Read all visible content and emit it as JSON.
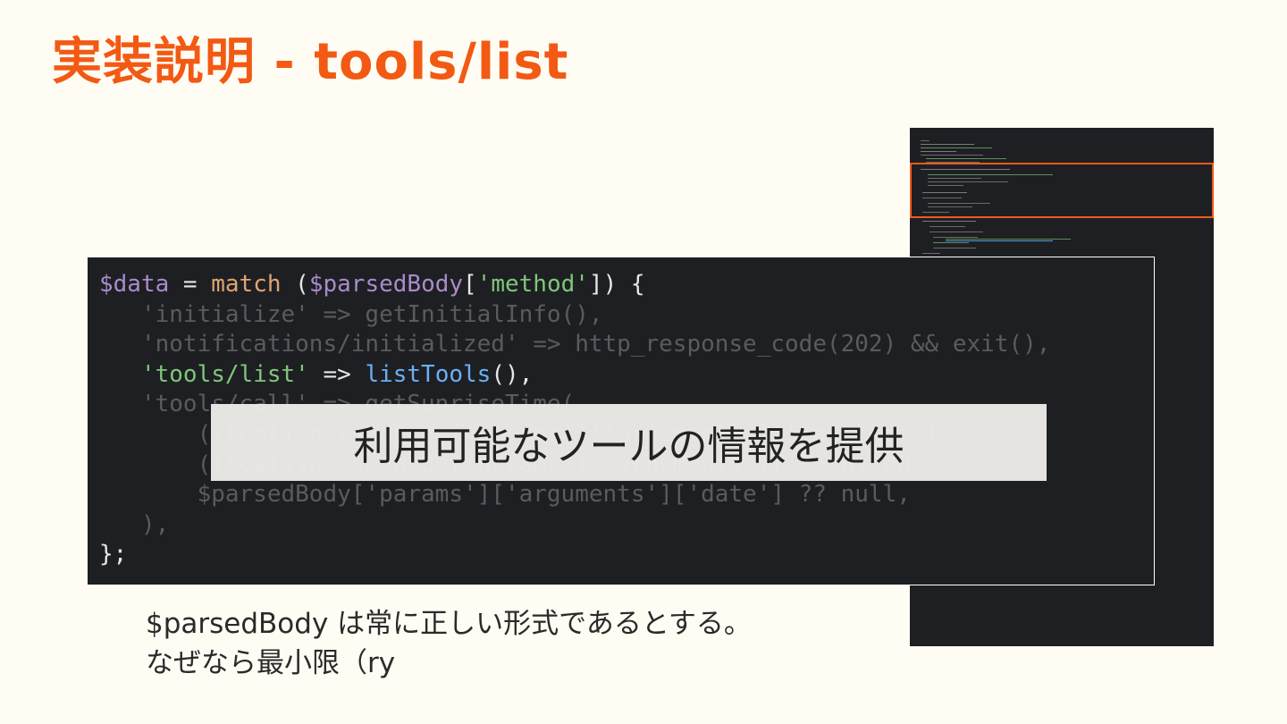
{
  "slide": {
    "title": "実装説明 - tools/list"
  },
  "code": {
    "lines": [
      [
        {
          "t": "$data",
          "c": "var"
        },
        {
          "t": " = ",
          "c": "plain"
        },
        {
          "t": "match",
          "c": "fn"
        },
        {
          "t": " (",
          "c": "plain"
        },
        {
          "t": "$parsedBody",
          "c": "var"
        },
        {
          "t": "[",
          "c": "plain"
        },
        {
          "t": "'method'",
          "c": "str"
        },
        {
          "t": "]) {",
          "c": "plain"
        }
      ],
      [
        {
          "t": "   'initialize' => getInitialInfo(),",
          "c": "dim"
        }
      ],
      [
        {
          "t": "   'notifications/initialized' => http_response_code(202) && exit(),",
          "c": "dim"
        }
      ],
      [
        {
          "t": "   ",
          "c": "plain"
        },
        {
          "t": "'tools/list'",
          "c": "str"
        },
        {
          "t": " => ",
          "c": "plain"
        },
        {
          "t": "listTools",
          "c": "blue"
        },
        {
          "t": "(),",
          "c": "plain"
        }
      ],
      [
        {
          "t": "   'tools/call' => getSunriseTime(",
          "c": "dim"
        }
      ],
      [
        {
          "t": "       (float)$parsedBody['params']['arguments']['latitude'],",
          "c": "dim"
        }
      ],
      [
        {
          "t": "       (float)$parsedBody['params']['arguments']['longitude'],",
          "c": "dim"
        }
      ],
      [
        {
          "t": "       $parsedBody['params']['arguments']['date'] ?? null,",
          "c": "dim"
        }
      ],
      [
        {
          "t": "   ),",
          "c": "dim"
        }
      ],
      [
        {
          "t": "};",
          "c": "plain"
        }
      ]
    ]
  },
  "overlay": {
    "text": "利用可能なツールの情報を提供"
  },
  "caption": {
    "line1": "$parsedBody は常に正しい形式であるとする。",
    "line2": "なぜなら最小限（ry"
  },
  "colors": {
    "title": "#f25a14",
    "highlight": "#f05a1a",
    "code_bg": "#1e1f23",
    "page_bg": "#fffcf4"
  }
}
